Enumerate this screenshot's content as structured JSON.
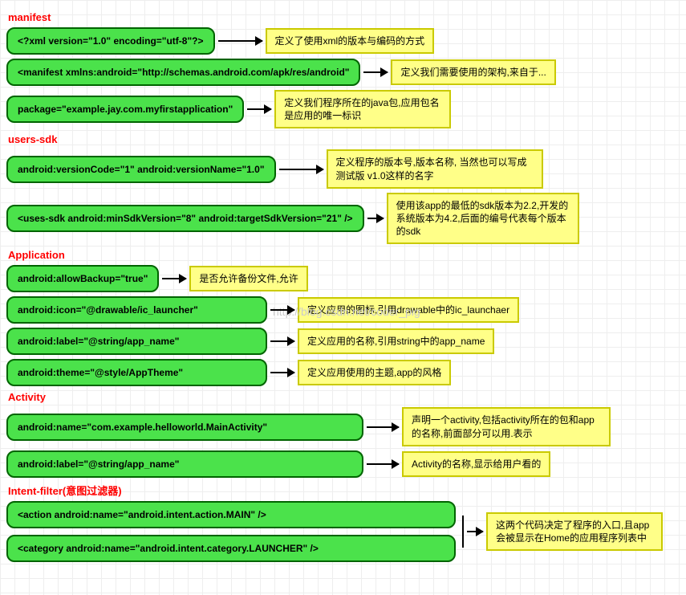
{
  "sections": {
    "manifest": "manifest",
    "usersSdk": "users-sdk",
    "application": "Application",
    "activity": "Activity",
    "intentFilter": "Intent-filter(意图过滤器)"
  },
  "manifest": {
    "xmlDecl": "<?xml version=\"1.0\" encoding=\"utf-8\"?>",
    "xmlDeclDesc": "定义了使用xml的版本与编码的方式",
    "manifestTag": "<manifest xmlns:android=\"http://schemas.android.com/apk/res/android\"",
    "manifestTagDesc": "定义我们需要使用的架构,来自于...",
    "packageAttr": "package=\"example.jay.com.myfirstapplication\"",
    "packageAttrDesc": "定义我们程序所在的java包,应用包名是应用的唯一标识"
  },
  "usersSdk": {
    "version": "android:versionCode=\"1\"    android:versionName=\"1.0\"",
    "versionDesc": "定义程序的版本号,版本名称, 当然也可以写成测试版 v1.0这样的名字",
    "usesSdk": "<uses-sdk  android:minSdkVersion=\"8\"  android:targetSdkVersion=\"21\" />",
    "usesSdkDesc": "使用该app的最低的sdk版本为2.2,开发的系统版本为4.2,后面的编号代表每个版本的sdk"
  },
  "application": {
    "allowBackup": "android:allowBackup=\"true\"",
    "allowBackupDesc": "是否允许备份文件,允许",
    "icon": "android:icon=\"@drawable/ic_launcher\"",
    "iconDesc": "定义应用的图标,引用drawable中的ic_launchaer",
    "label": "android:label=\"@string/app_name\"",
    "labelDesc": "定义应用的名称,引用string中的app_name",
    "theme": "android:theme=\"@style/AppTheme\"",
    "themeDesc": "定义应用使用的主题,app的风格"
  },
  "activity": {
    "name": "android:name=\"com.example.helloworld.MainActivity\"",
    "nameDesc": "声明一个activity,包括activity所在的包和app的名称,前面部分可以用.表示",
    "label": "android:label=\"@string/app_name\"",
    "labelDesc": "Activity的名称,显示给用户看的"
  },
  "intentFilter": {
    "action": "<action android:name=\"android.intent.action.MAIN\" />",
    "category": "<category android:name=\"android.intent.category.LAUNCHER\" />",
    "desc": "这两个代码决定了程序的入口,且app会被显示在Home的应用程序列表中"
  },
  "watermark": "http://blog.csdn.net/coder_pig"
}
